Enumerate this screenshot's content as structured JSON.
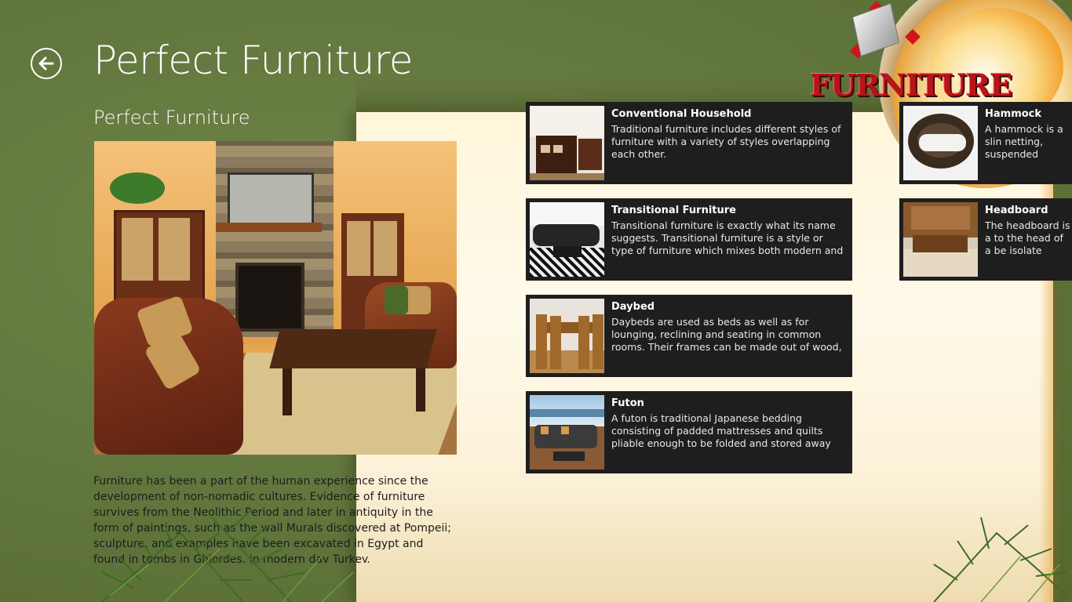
{
  "header": {
    "title": "Perfect Furniture",
    "back_label": "Back"
  },
  "logo": {
    "text": "FURNITURE"
  },
  "detail": {
    "title": "Perfect Furniture",
    "description": "Furniture has been a part of the human experience since the development of non-nomadic cultures. Evidence of furniture survives from the Neolithic Period and later in antiquity in the form of paintings, such as the wall Murals discovered at Pompeii; sculpture, and examples have been excavated in Egypt and found in tombs in Ghiordes, in modern day Turkey."
  },
  "items": [
    {
      "title": "Conventional Household",
      "description": "Traditional furniture includes different styles of furniture with a variety of styles overlapping each other."
    },
    {
      "title": "Transitional Furniture",
      "description": "Transitional furniture is exactly what its name suggests. Transitional furniture is a style or type of furniture which mixes both modern and traditional…"
    },
    {
      "title": "Daybed",
      "description": "Daybeds are used as beds as well as for lounging, reclining and seating in common rooms. Their frames can be made out of wood, metal or a…"
    },
    {
      "title": "Futon",
      "description": "A futon is traditional Japanese bedding consisting of padded mattresses and quilts pliable enough to be folded and stored away during the day, allowing…"
    },
    {
      "title": "Hammock",
      "description": "A hammock is a slin netting, suspended swinging, sleeping,"
    },
    {
      "title": "Headboard",
      "description": "The headboard is a to the head of a be isolate sleepers fron"
    }
  ],
  "colors": {
    "background": "#62783e",
    "tile": "#1f1e1e",
    "text_light": "#ffffff",
    "logo_red": "#b8141a"
  }
}
